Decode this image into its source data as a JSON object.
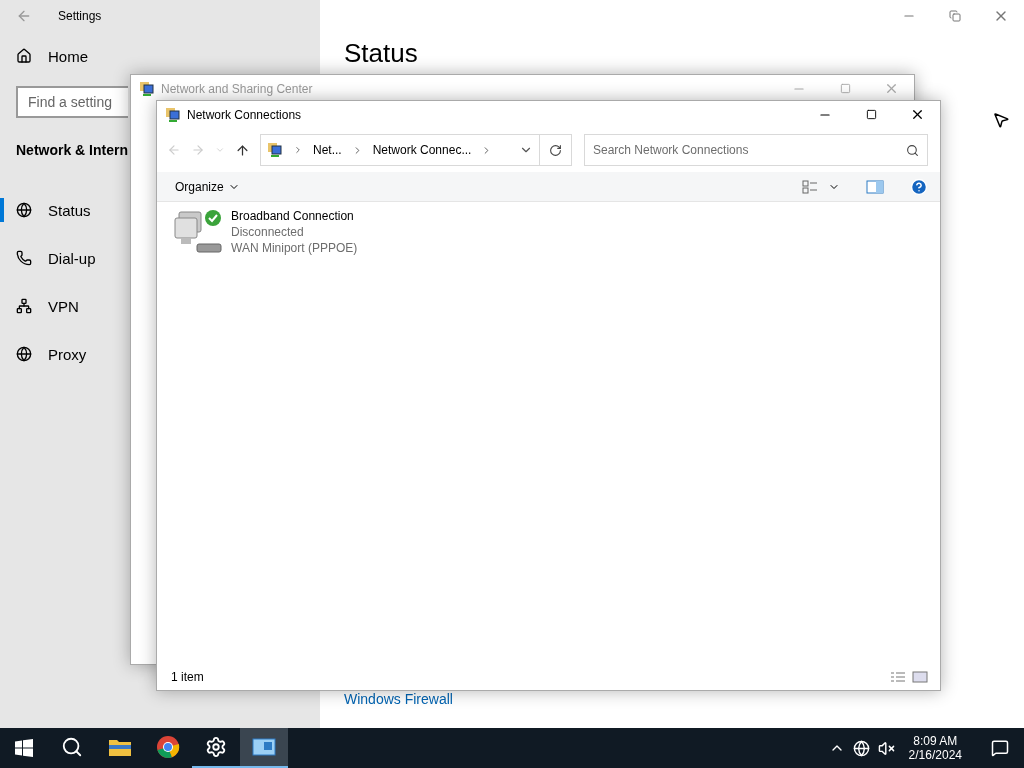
{
  "settings": {
    "title": "Settings",
    "home": "Home",
    "search": {
      "placeholder": "Find a setting"
    },
    "section": "Network & Intern",
    "items": [
      {
        "kind": "status",
        "label": "Status",
        "selected": true
      },
      {
        "kind": "dialup",
        "label": "Dial-up",
        "selected": false
      },
      {
        "kind": "vpn",
        "label": "VPN",
        "selected": false
      },
      {
        "kind": "proxy",
        "label": "Proxy",
        "selected": false
      }
    ],
    "heading": "Status",
    "link": "Windows Firewall"
  },
  "sharing_center": {
    "title": "Network and Sharing Center"
  },
  "connections": {
    "title": "Network Connections",
    "breadcrumb": [
      "Net...",
      "Network Connec..."
    ],
    "search": {
      "placeholder": "Search Network Connections"
    },
    "organize": "Organize",
    "items": [
      {
        "name": "Broadband Connection",
        "status": "Disconnected",
        "device": "WAN Miniport (PPPOE)"
      }
    ],
    "status_bar": "1 item"
  },
  "taskbar": {
    "apps": [
      {
        "kind": "search",
        "running": false,
        "selected": false
      },
      {
        "kind": "explorer",
        "running": false,
        "selected": false
      },
      {
        "kind": "chrome",
        "running": false,
        "selected": false
      },
      {
        "kind": "settings",
        "running": true,
        "selected": false
      },
      {
        "kind": "network",
        "running": true,
        "selected": true
      }
    ],
    "time": "8:09 AM",
    "date": "2/16/2024"
  }
}
